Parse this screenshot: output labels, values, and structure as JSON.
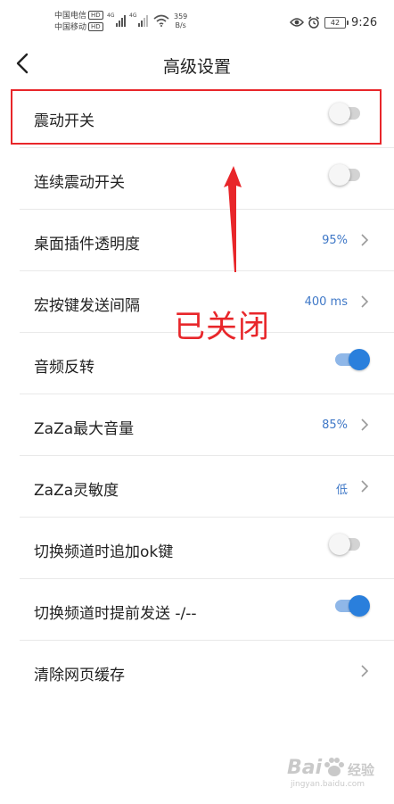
{
  "status_bar": {
    "carrier_1": "中国电信",
    "carrier_2": "中国移动",
    "hd_badge": "HD",
    "signal_label": "4G",
    "net_speed_value": "359",
    "net_speed_unit": "B/s",
    "battery": "42",
    "time": "9:26"
  },
  "header": {
    "title": "高级设置"
  },
  "settings": [
    {
      "label": "震动开关",
      "type": "toggle",
      "on": false
    },
    {
      "label": "连续震动开关",
      "type": "toggle",
      "on": false
    },
    {
      "label": "桌面插件透明度",
      "type": "value",
      "value": "95%"
    },
    {
      "label": "宏按键发送间隔",
      "type": "value",
      "value": "400 ms"
    },
    {
      "label": "音频反转",
      "type": "toggle",
      "on": true
    },
    {
      "label": "ZaZa最大音量",
      "type": "value",
      "value": "85%"
    },
    {
      "label": "ZaZa灵敏度",
      "type": "value",
      "value": "低"
    },
    {
      "label": "切换频道时追加ok键",
      "type": "toggle",
      "on": false
    },
    {
      "label": "切换频道时提前发送 -/--",
      "type": "toggle",
      "on": true
    },
    {
      "label": "清除网页缓存",
      "type": "link"
    }
  ],
  "annotation": {
    "text": "已关闭",
    "color": "#e8262a"
  },
  "watermark": {
    "brand": "Bai",
    "brand_suffix": "经验",
    "url": "jingyan.baidu.com"
  },
  "colors": {
    "accent": "#2a7fdc",
    "value_text": "#3f78c7",
    "annotation": "#e8262a"
  }
}
